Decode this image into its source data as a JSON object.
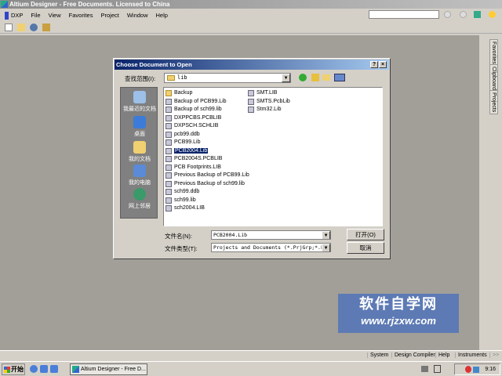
{
  "app": {
    "title": "Altium Designer - Free Documents. Licensed to China"
  },
  "menu": [
    "DXP",
    "File",
    "View",
    "Favorites",
    "Project",
    "Window",
    "Help"
  ],
  "right_panel": {
    "tabs": [
      "Favorites",
      "Clipboard",
      "Projects"
    ]
  },
  "dialog": {
    "title": "Choose Document to Open",
    "help_btn": "?",
    "close_btn": "×",
    "look_in_label": "查找范围(I):",
    "look_in_value": "lib",
    "places": [
      "我最近的文档",
      "桌面",
      "我的文档",
      "我的电脑",
      "网上邻居"
    ],
    "files_col1": [
      "Backup",
      "Backup of PCB99.Lib",
      "Backup of sch99.lib",
      "DXPPCBS.PCBLIB",
      "DXPSCH.SCHLIB",
      "pcb99.ddb",
      "PCB99.Lib",
      "PCB2004.Lib",
      "PCB2004S.PCBLIB",
      "PCB Footprints.LIB",
      "Previous Backup of PCB99.Lib",
      "Previous Backup of sch99.lib",
      "sch99.ddb",
      "sch99.lib",
      "sch2004.LIB"
    ],
    "files_col2": [
      "SMT.LIB",
      "SMTS.PcbLib",
      "Stm32.Lib"
    ],
    "selected_file": "PCB2004.Lib",
    "filename_label": "文件名(N):",
    "filename_value": "PCB2004.Lib",
    "filetype_label": "文件类型(T):",
    "filetype_value": "Projects and Documents (*.PrjGrp;*.Pr",
    "open_btn": "打开(O)",
    "cancel_btn": "取消"
  },
  "statusbar": [
    "System",
    "Design Compiler",
    "Help",
    "Instruments",
    ">>"
  ],
  "taskbar": {
    "start": "开始",
    "task": "Altium Designer - Free D...",
    "clock": "9:16"
  },
  "watermark": {
    "line1": "软件自学网",
    "line2": "www.rjzxw.com"
  }
}
